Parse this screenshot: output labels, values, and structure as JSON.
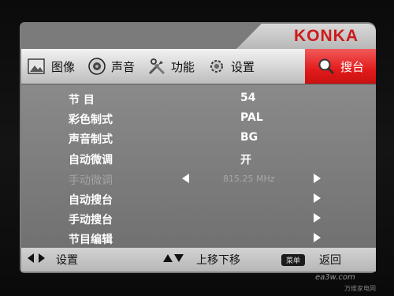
{
  "brand": {
    "logo": "KONKA"
  },
  "tabs": [
    {
      "label": "图像",
      "icon": "picture-icon",
      "active": false
    },
    {
      "label": "声音",
      "icon": "speaker-icon",
      "active": false
    },
    {
      "label": "功能",
      "icon": "tools-icon",
      "active": false
    },
    {
      "label": "设置",
      "icon": "gear-icon",
      "active": false
    },
    {
      "label": "搜台",
      "icon": "magnifier-icon",
      "active": true
    }
  ],
  "menu": {
    "items": [
      {
        "label": "节  目",
        "value": "54",
        "disabled": false
      },
      {
        "label": "彩色制式",
        "value": "PAL",
        "disabled": false
      },
      {
        "label": "声音制式",
        "value": "BG",
        "disabled": false
      },
      {
        "label": "自动微调",
        "value": "开",
        "disabled": false
      },
      {
        "label": "手动微调",
        "value": "815.25 MHz",
        "disabled": true
      },
      {
        "label": "自动搜台",
        "value": "",
        "disabled": false
      },
      {
        "label": "手动搜台",
        "value": "",
        "disabled": false
      },
      {
        "label": "节目编辑",
        "value": "",
        "disabled": false
      }
    ]
  },
  "footer": {
    "settings_label": "设置",
    "move_label": "上移下移",
    "menu_key": "菜单",
    "back_label": "返回"
  },
  "watermark": {
    "site": "ea3w.com",
    "sub": "万维家电网"
  },
  "colors": {
    "accent": "#e21b1b",
    "logo": "#cc1b1b"
  }
}
